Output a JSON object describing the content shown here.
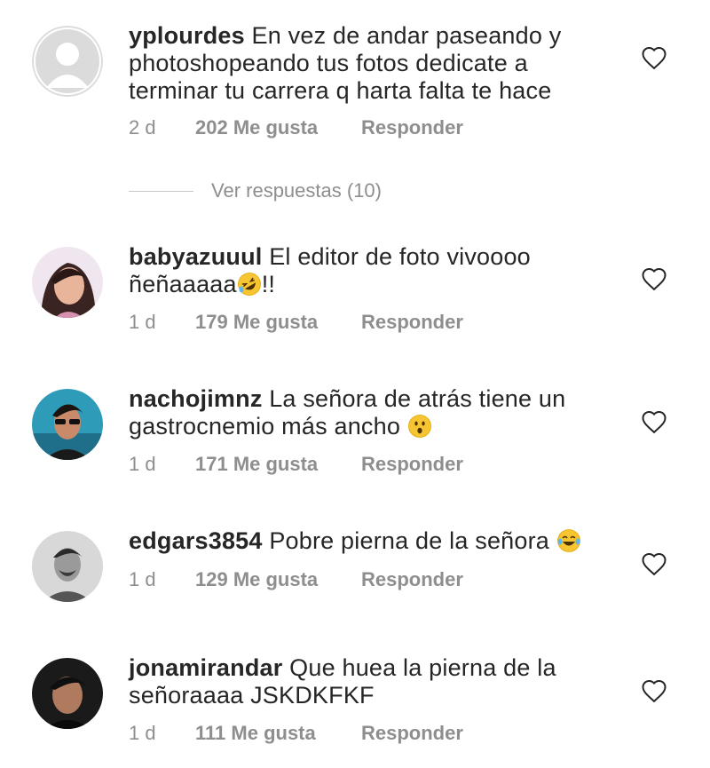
{
  "comments": [
    {
      "username": "yplourdes",
      "text_lines": [
        "En vez de andar paseando y",
        "photoshopeando tus fotos dedicate a",
        "terminar tu carrera q harta falta te hace"
      ],
      "time": "2 d",
      "likes": "202 Me gusta",
      "reply": "Responder"
    },
    {
      "username": "babyazuuul",
      "text_lines": [
        "El editor de foto  vivoooo",
        "ñeñaaaaa",
        "!!"
      ],
      "time": "1 d",
      "likes": "179 Me gusta",
      "reply": "Responder"
    },
    {
      "username": "nachojimnz",
      "text_lines": [
        "La señora de atrás tiene un",
        "gastrocnemio más ancho"
      ],
      "time": "1 d",
      "likes": "171 Me gusta",
      "reply": "Responder"
    },
    {
      "username": "edgars3854",
      "text_lines": [
        "Pobre pierna de la señora"
      ],
      "time": "1 d",
      "likes": "129 Me gusta",
      "reply": "Responder"
    },
    {
      "username": "jonamirandar",
      "text_lines": [
        "Que huea la pierna de la",
        "señoraaaa JSKDKFKF"
      ],
      "time": "1 d",
      "likes": "111 Me gusta",
      "reply": "Responder"
    }
  ],
  "view_replies": "Ver respuestas (10)",
  "colors": {
    "text": "#262626",
    "meta": "#8e8e8e",
    "divider": "#c7c7c7"
  },
  "icons": [
    "heart-outline-icon",
    "default-avatar-icon",
    "rolling-laughing-emoji",
    "surprised-emoji",
    "tears-of-joy-emoji"
  ]
}
